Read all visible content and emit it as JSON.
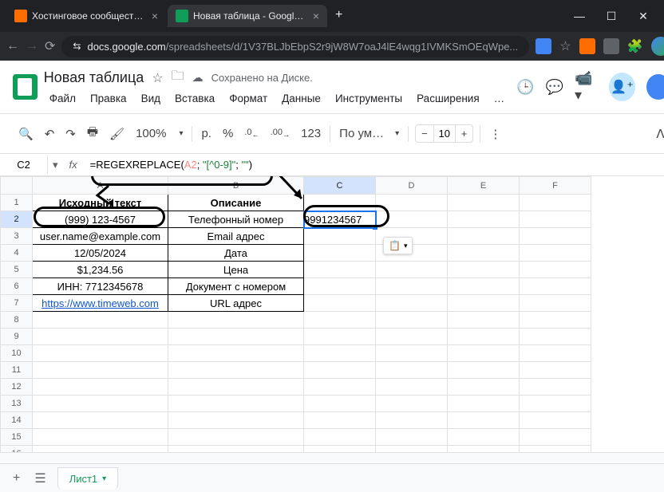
{
  "browser": {
    "tabs": [
      {
        "title": "Хостинговое сообщество «Tim...",
        "active": false
      },
      {
        "title": "Новая таблица - Google Табли...",
        "active": true
      }
    ],
    "url_domain": "docs.google.com",
    "url_path": "/spreadsheets/d/1V37BLJbEbpS2r9jW8W7oaJ4lE4wqg1IVMKSmOEqWpe..."
  },
  "doc": {
    "title": "Новая таблица",
    "saved_text": "Сохранено на Диске."
  },
  "menus": [
    "Файл",
    "Правка",
    "Вид",
    "Вставка",
    "Формат",
    "Данные",
    "Инструменты",
    "Расширения",
    "…"
  ],
  "toolbar": {
    "zoom": "100%",
    "currency": "р.",
    "pct": "%",
    "dec_dec": ".0",
    "inc_dec": ".00",
    "num123": "123",
    "font": "По ум…",
    "fontsize": "10"
  },
  "formula": {
    "cell_ref": "C2",
    "fn": "=REGEXREPLACE(",
    "arg_ref": "A2",
    "sep1": "; ",
    "arg_str1": "\"[^0-9]\"",
    "sep2": "; ",
    "arg_str2": "\"\"",
    "close": ")"
  },
  "columns": [
    "A",
    "B",
    "C",
    "D",
    "E",
    "F"
  ],
  "sheet": {
    "headers": {
      "A": "Исходный текст",
      "B": "Описание"
    },
    "rows": [
      {
        "A": "(999) 123-4567",
        "B": "Телефонный номер",
        "C": "9991234567"
      },
      {
        "A": "user.name@example.com",
        "B": "Email адрес"
      },
      {
        "A": "12/05/2024",
        "B": "Дата"
      },
      {
        "A": "$1,234.56",
        "B": "Цена"
      },
      {
        "A": "ИНН: 7712345678",
        "B": "Документ с номером"
      },
      {
        "A": "https://www.timeweb.com",
        "B": "URL адрес",
        "link": true
      }
    ]
  },
  "sheet_tabs": {
    "name": "Лист1"
  },
  "selected_cell": "C2",
  "paste_icon": "📋"
}
